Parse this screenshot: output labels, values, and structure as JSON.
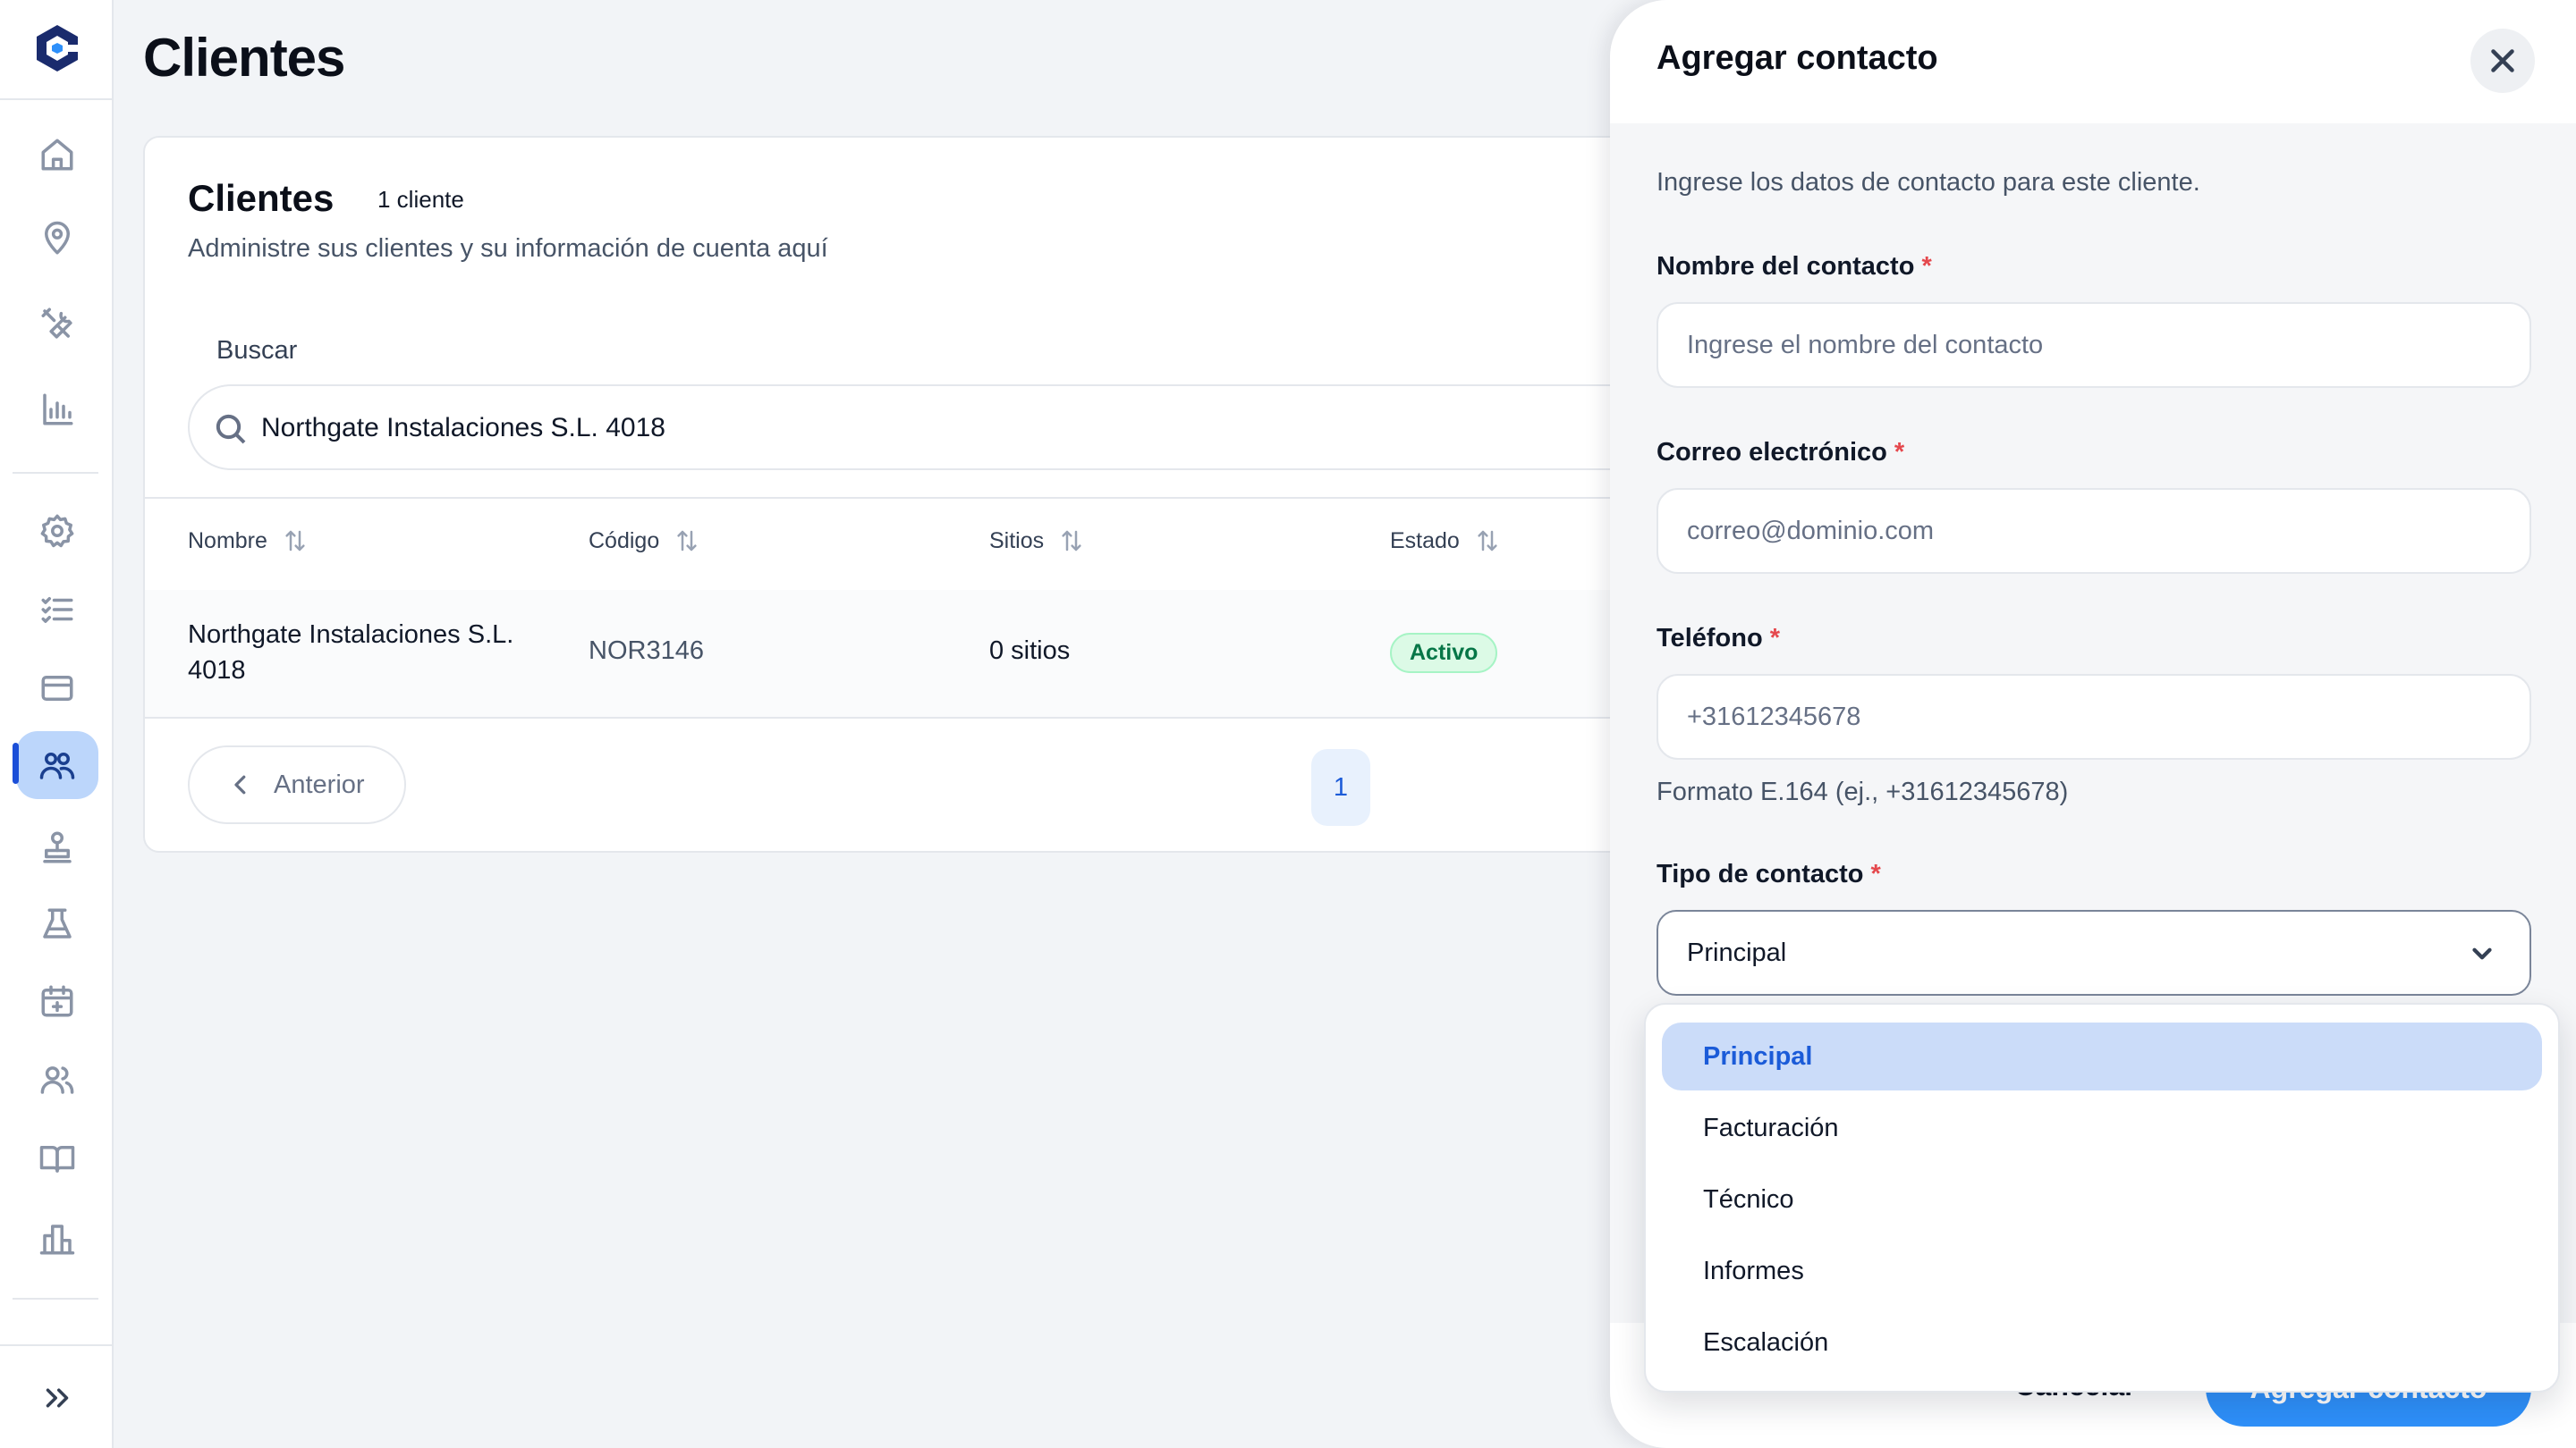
{
  "page": {
    "title": "Clientes"
  },
  "sidebar": {
    "items": [
      {
        "icon": "home-icon"
      },
      {
        "icon": "map-pin-icon"
      },
      {
        "icon": "tools-icon"
      },
      {
        "icon": "bar-chart-icon"
      },
      {
        "icon": "gear-icon"
      },
      {
        "icon": "checklist-icon"
      },
      {
        "icon": "credit-card-icon"
      },
      {
        "icon": "clients-icon",
        "active": true
      },
      {
        "icon": "stamp-icon"
      },
      {
        "icon": "lab-flask-icon"
      },
      {
        "icon": "calendar-add-icon"
      },
      {
        "icon": "users-icon"
      },
      {
        "icon": "book-icon"
      },
      {
        "icon": "building-chart-icon"
      }
    ],
    "expand_icon": "chevron-double-right-icon"
  },
  "card": {
    "title": "Clientes",
    "count": "1 cliente",
    "subtitle": "Administre sus clientes y su información de cuenta aquí",
    "search_label": "Buscar",
    "search_value": "Northgate Instalaciones S.L. 4018"
  },
  "table": {
    "columns": [
      "Nombre",
      "Código",
      "Sitios",
      "Estado"
    ],
    "rows": [
      {
        "name": "Northgate Instalaciones S.L. 4018",
        "code": "NOR3146",
        "sites": "0 sitios",
        "status": "Activo"
      }
    ]
  },
  "pagination": {
    "prev_label": "Anterior",
    "current_page": "1"
  },
  "drawer": {
    "title": "Agregar contacto",
    "description": "Ingrese los datos de contacto para este cliente.",
    "fields": {
      "name": {
        "label": "Nombre del contacto",
        "placeholder": "Ingrese el nombre del contacto"
      },
      "email": {
        "label": "Correo electrónico",
        "placeholder": "correo@dominio.com"
      },
      "phone": {
        "label": "Teléfono",
        "placeholder": "+31612345678",
        "hint": "Formato E.164 (ej., +31612345678)"
      },
      "type": {
        "label": "Tipo de contacto",
        "value": "Principal",
        "options": [
          "Principal",
          "Facturación",
          "Técnico",
          "Informes",
          "Escalación"
        ]
      }
    },
    "required_mark": "*",
    "cancel_label": "Cancelar",
    "submit_label": "Agregar contacto"
  },
  "colors": {
    "accent": "#2e90fa",
    "active_nav": "#bcd6fb",
    "badge_bg": "#dcfae6",
    "badge_text": "#067647",
    "required": "#e5484d"
  }
}
